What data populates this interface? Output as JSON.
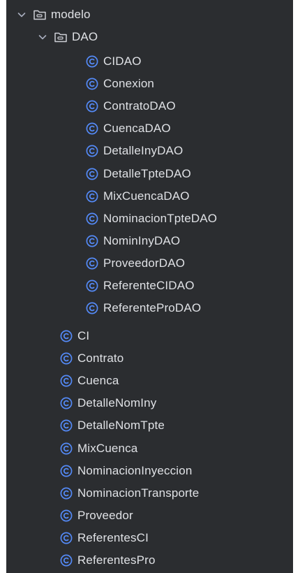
{
  "tree": {
    "root": {
      "label": "modelo",
      "icon": "folder-icon",
      "expanded": true
    },
    "dao": {
      "label": "DAO",
      "icon": "folder-icon",
      "expanded": true
    },
    "dao_classes": [
      "CIDAO",
      "Conexion",
      "ContratoDAO",
      "CuencaDAO",
      "DetalleInyDAO",
      "DetalleTpteDAO",
      "MixCuencaDAO",
      "NominacionTpteDAO",
      "NominInyDAO",
      "ProveedorDAO",
      "ReferenteCIDAO",
      "ReferenteProDAO"
    ],
    "model_classes": [
      "CI",
      "Contrato",
      "Cuenca",
      "DetalleNomIny",
      "DetalleNomTpte",
      "MixCuenca",
      "NominacionInyeccion",
      "NominacionTransporte",
      "Proveedor",
      "ReferentesCI",
      "ReferentesPro"
    ]
  },
  "colors": {
    "panel_bg": "#2b2d30",
    "text": "#dfe1e5",
    "class_icon": "#548af7",
    "chevron": "#a8adbd"
  },
  "icons": {
    "expand": "chevron-down-icon",
    "folder": "folder-icon",
    "class": "class-icon"
  }
}
